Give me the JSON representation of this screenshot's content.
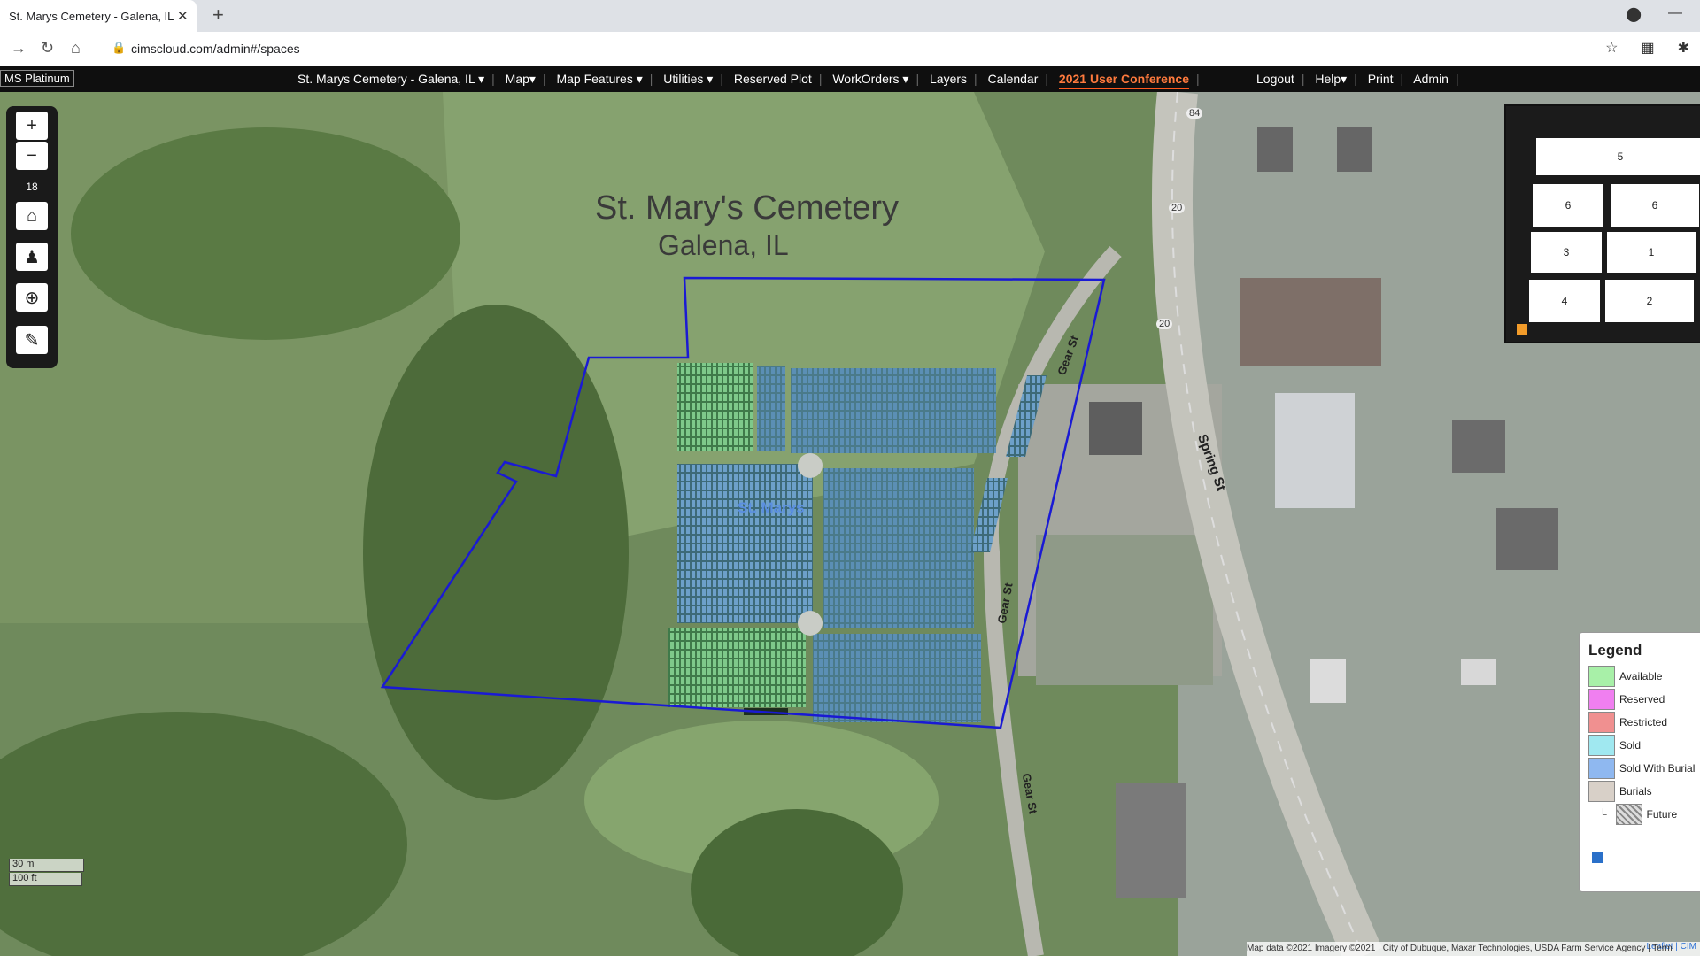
{
  "browser": {
    "tab_title": "St. Marys Cemetery - Galena, IL -",
    "close_glyph": "✕",
    "new_tab_glyph": "+",
    "url": "cimscloud.com/admin#/spaces"
  },
  "menubar": {
    "brand": "MS Platinum",
    "site": "St. Marys Cemetery - Galena, IL ▾",
    "items": [
      "Map▾",
      "Map Features ▾",
      "Utilities ▾",
      "Reserved Plot",
      "WorkOrders ▾",
      "Layers",
      "Calendar"
    ],
    "conference": "2021 User Conference",
    "right_items": [
      "Logout",
      "Help▾",
      "Print",
      "Admin"
    ]
  },
  "map": {
    "title": "St. Mary's Cemetery",
    "subtitle": "Galena, IL",
    "section_label": "St. Marys",
    "streets": {
      "gear1": "Gear St",
      "gear2": "Gear St",
      "gear3": "Gear St",
      "spring": "Spring St"
    },
    "highways": [
      "84",
      "20",
      "20"
    ],
    "boundary_color": "#1a1ad4"
  },
  "controls": {
    "zoom_in": "+",
    "zoom_out": "−",
    "zoom_level": "18",
    "icons": [
      "home-icon",
      "street-view-icon",
      "zoom-search-icon",
      "measure-ruler-icon"
    ]
  },
  "scale": {
    "metric": "30 m",
    "imperial": "100 ft"
  },
  "minimap": {
    "lots": [
      "5",
      "6",
      "6",
      "3",
      "1",
      "4",
      "2"
    ]
  },
  "legend": {
    "title": "Legend",
    "items": [
      {
        "label": "Available",
        "color": "#a8f0a8"
      },
      {
        "label": "Reserved",
        "color": "#f07ff0"
      },
      {
        "label": "Restricted",
        "color": "#f09090"
      },
      {
        "label": "Sold",
        "color": "#a0e8f0"
      },
      {
        "label": "Sold With Burial",
        "color": "#8fb8f0"
      },
      {
        "label": "Burials",
        "color": "#d8d0c8"
      }
    ],
    "future": "Future"
  },
  "attribution": {
    "leaflet": "Leaflet | CIM",
    "text": "Map data ©2021 Imagery ©2021 , City of Dubuque, Maxar Technologies, USDA Farm Service Agency | Term"
  }
}
